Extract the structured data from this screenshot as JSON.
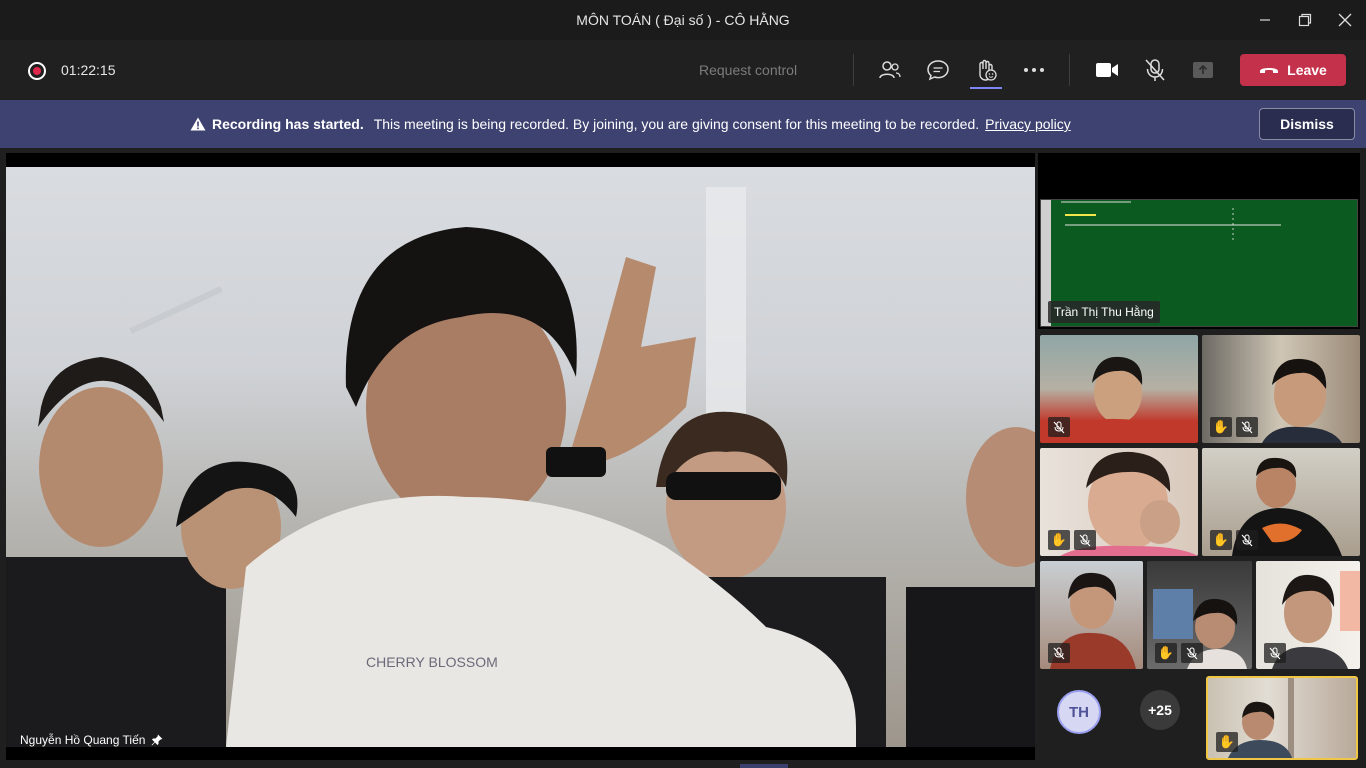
{
  "window": {
    "title": "MÔN TOÁN ( Đại số ) - CÔ HẰNG",
    "minimize_icon": "minimize-icon",
    "maximize_icon": "restore-icon",
    "close_icon": "close-icon"
  },
  "controls": {
    "recording_time": "01:22:15",
    "request_control": "Request control",
    "leave_label": "Leave",
    "buttons": [
      "participants-icon",
      "chat-icon",
      "reactions-icon",
      "more-icon",
      "camera-icon",
      "mic-off-icon",
      "share-tray-icon"
    ]
  },
  "banner": {
    "title": "Recording has started.",
    "message": "This meeting is being recorded. By joining, you are giving consent for this meeting to be recorded.",
    "link": "Privacy policy",
    "dismiss": "Dismiss"
  },
  "main_stage": {
    "participant_name": "Nguyễn Hồ Quang Tiến",
    "pin_icon": "pin-icon"
  },
  "gallery": {
    "shared_screen_name": "Trần Thị Thu Hằng",
    "avatar_initials": "TH",
    "overflow_count": "+25"
  },
  "colors": {
    "accent": "#7f85f5",
    "leave": "#c4314b",
    "banner": "#3e4270",
    "self_highlight": "#f0c646"
  }
}
